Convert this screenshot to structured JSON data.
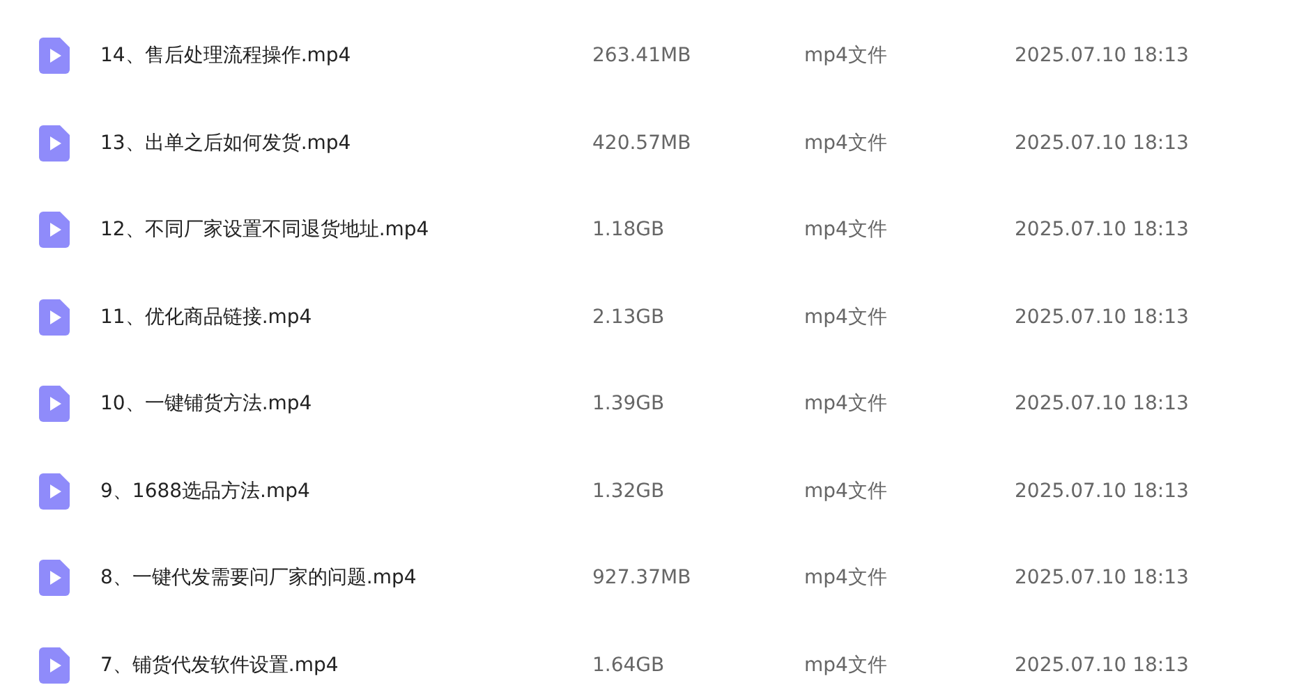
{
  "files": [
    {
      "name": "14、售后处理流程操作.mp4",
      "size": "263.41MB",
      "type": "mp4文件",
      "modified": "2025.07.10 18:13"
    },
    {
      "name": "13、出单之后如何发货.mp4",
      "size": "420.57MB",
      "type": "mp4文件",
      "modified": "2025.07.10 18:13"
    },
    {
      "name": "12、不同厂家设置不同退货地址.mp4",
      "size": "1.18GB",
      "type": "mp4文件",
      "modified": "2025.07.10 18:13"
    },
    {
      "name": "11、优化商品链接.mp4",
      "size": "2.13GB",
      "type": "mp4文件",
      "modified": "2025.07.10 18:13"
    },
    {
      "name": "10、一键铺货方法.mp4",
      "size": "1.39GB",
      "type": "mp4文件",
      "modified": "2025.07.10 18:13"
    },
    {
      "name": "9、1688选品方法.mp4",
      "size": "1.32GB",
      "type": "mp4文件",
      "modified": "2025.07.10 18:13"
    },
    {
      "name": "8、一键代发需要问厂家的问题.mp4",
      "size": "927.37MB",
      "type": "mp4文件",
      "modified": "2025.07.10 18:13"
    },
    {
      "name": "7、铺货代发软件设置.mp4",
      "size": "1.64GB",
      "type": "mp4文件",
      "modified": "2025.07.10 18:13"
    }
  ]
}
